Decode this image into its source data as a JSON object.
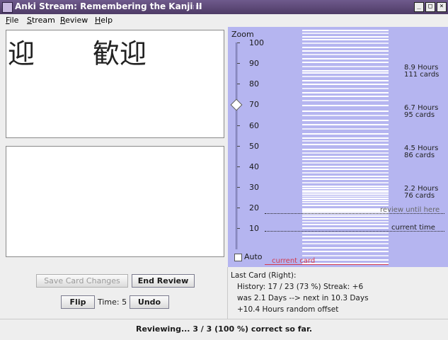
{
  "window": {
    "title": "Anki Stream: Remembering the Kanji II",
    "controls": [
      "_",
      "□",
      "×"
    ]
  },
  "menubar": {
    "items": [
      {
        "first": "F",
        "rest": "ile"
      },
      {
        "first": "S",
        "rest": "tream"
      },
      {
        "first": "R",
        "rest": "eview"
      },
      {
        "first": "H",
        "rest": "elp"
      }
    ]
  },
  "card": {
    "front_left": "迎",
    "front_right": "歓迎",
    "back": ""
  },
  "zoom": {
    "title": "Zoom",
    "ticks": [
      "100",
      "90",
      "80",
      "70",
      "60",
      "50",
      "40",
      "30",
      "20",
      "10"
    ],
    "value": 70,
    "auto_label": "Auto",
    "auto_checked": false
  },
  "graph": {
    "markers": [
      {
        "hours": "8.9 Hours",
        "cards": "111 cards"
      },
      {
        "hours": "6.7 Hours",
        "cards": "95 cards"
      },
      {
        "hours": "4.5 Hours",
        "cards": "86 cards"
      },
      {
        "hours": "2.2 Hours",
        "cards": "76 cards"
      }
    ],
    "review_until_label": "review until here",
    "current_time_label": "current time",
    "current_card_label": "current card",
    "bar_color": "#ffffff",
    "background_color": "#b5b5f0",
    "current_card_color": "#d23c50"
  },
  "buttons": {
    "save_changes": "Save Card Changes",
    "end_review": "End Review",
    "flip": "Flip",
    "undo": "Undo",
    "time_label": "Time: 5"
  },
  "last_card": {
    "title": "Last Card (Right):",
    "history": "History: 17 / 23 (73 %)  Streak: +6",
    "interval": "was 2.1 Days --> next in 10.3 Days",
    "offset": "+10.4 Hours random offset"
  },
  "status": {
    "text": "Reviewing... 3 / 3 (100 %) correct so far."
  }
}
